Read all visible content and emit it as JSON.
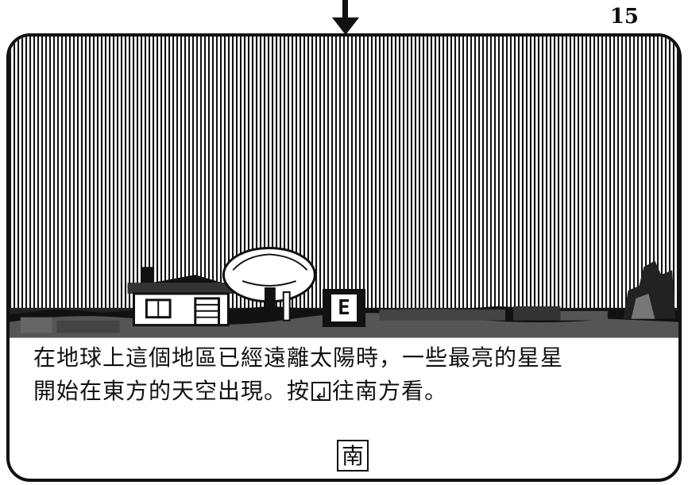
{
  "page_number": "15",
  "game": {
    "marker_letter": "E",
    "caption_line1": "在地球上這個地區已經遠離太陽時，一些最亮的星星",
    "caption_line2_before": "開始在東方的天空出現。按",
    "caption_line2_after": "往南方看。",
    "enter_icon": "enter-key-icon",
    "direction_button": "南"
  }
}
